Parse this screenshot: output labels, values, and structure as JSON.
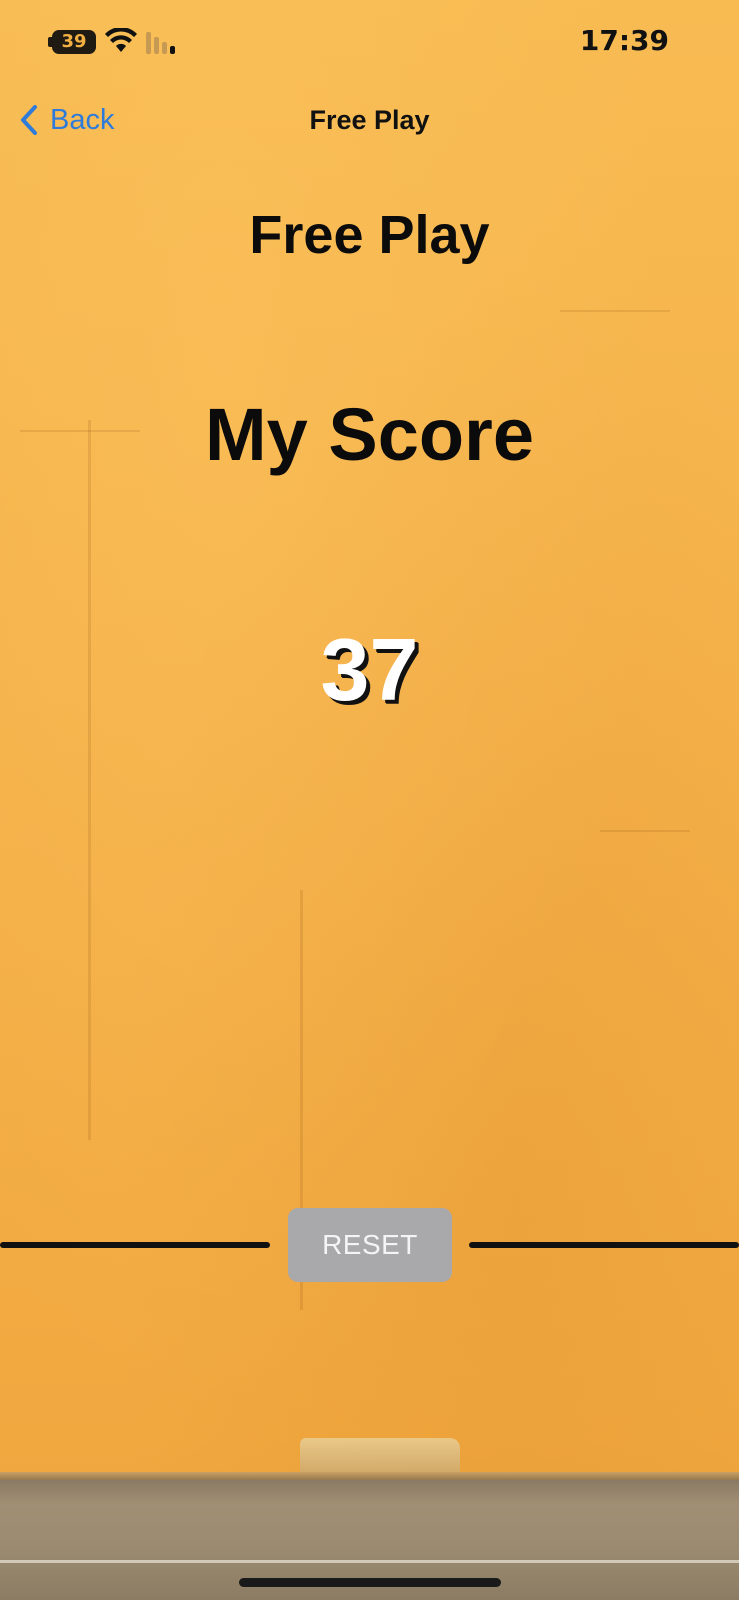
{
  "status_bar": {
    "battery_level": "39",
    "time": "17:39"
  },
  "nav": {
    "back_label": "Back",
    "title": "Free Play"
  },
  "main": {
    "page_title": "Free Play",
    "score_label": "My Score",
    "score_value": "37",
    "reset_label": "RESET"
  },
  "colors": {
    "background": "#f6b44a",
    "accent_link": "#2f7bd9",
    "button_bg": "#a9a9ac",
    "text_dark": "#0b0b0b"
  }
}
